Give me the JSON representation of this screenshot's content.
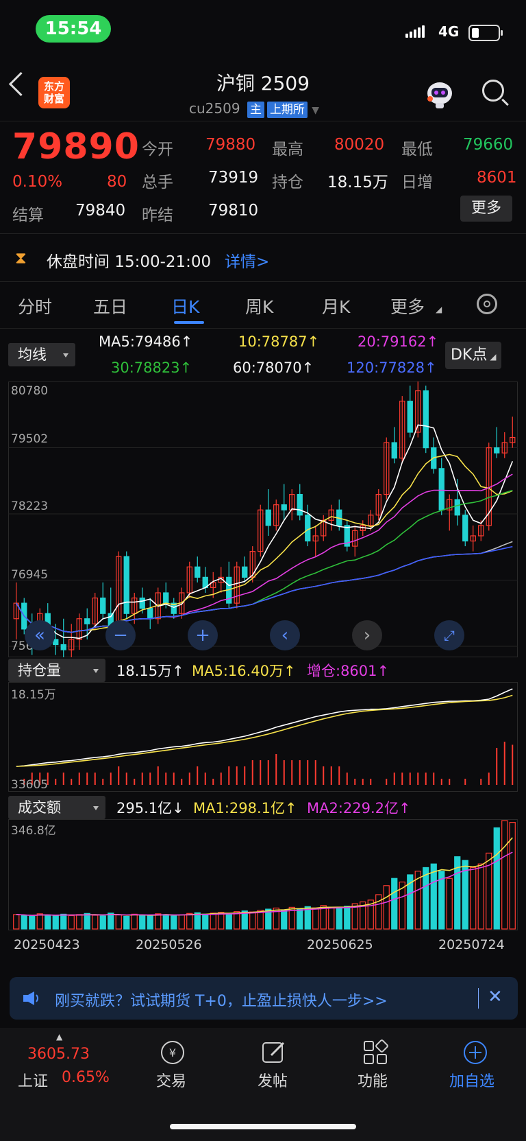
{
  "status_bar": {
    "time": "15:54",
    "network": "4G"
  },
  "header": {
    "logo_line1": "东方",
    "logo_line2": "财富",
    "title": "沪铜 2509",
    "code": "cu2509",
    "tag_main": "主",
    "tag_exchange": "上期所"
  },
  "quote": {
    "price": "79890",
    "change_pct": "0.10%",
    "change": "80",
    "open_label": "今开",
    "open": "79880",
    "high_label": "最高",
    "high": "80020",
    "low_label": "最低",
    "low": "79660",
    "volume_label": "总手",
    "volume": "73919",
    "position_label": "持仓",
    "position": "18.15万",
    "daily_inc_label": "日增",
    "daily_inc": "8601",
    "settle_label": "结算",
    "settle": "79840",
    "prev_settle_label": "昨结",
    "prev_settle": "79810",
    "more": "更多"
  },
  "notice": {
    "text": "休盘时间 15:00-21:00",
    "link": "详情>"
  },
  "tabs": [
    "分时",
    "五日",
    "日K",
    "周K",
    "月K",
    "更多"
  ],
  "ma_bar": {
    "selector": "均线",
    "ma5": "MA5:79486↑",
    "ma10": "10:78787↑",
    "ma20": "20:79162↑",
    "ma30": "30:78823↑",
    "ma60": "60:78070↑",
    "ma120": "120:77828↑",
    "dk": "DK点"
  },
  "kline_axis": [
    "80780",
    "79502",
    "78223",
    "76945",
    "75667"
  ],
  "position_bar": {
    "selector": "持仓量",
    "value": "18.15万↑",
    "ma5": "MA5:16.40万↑",
    "inc": "增仓:8601↑"
  },
  "position_axis": [
    "18.15万",
    "33605"
  ],
  "amount_bar": {
    "selector": "成交额",
    "value": "295.1亿↓",
    "ma1": "MA1:298.1亿↑",
    "ma2": "MA2:229.2亿↑"
  },
  "amount_axis": [
    "346.8亿"
  ],
  "dates": [
    "20250423",
    "20250526",
    "20250625",
    "20250724"
  ],
  "banner": {
    "text": "刚买就跌？试试期货 T+0，止盈止损快人一步>>"
  },
  "bottom_nav": {
    "index_value": "3605.73",
    "index_name": "上证",
    "index_change": "0.65%",
    "items": [
      "交易",
      "发帖",
      "功能",
      "加自选"
    ]
  },
  "colors": {
    "up": "#ff3b30",
    "down": "#22d3d3",
    "accent": "#3d86ff",
    "background": "#0b0b0d"
  },
  "chart_data": {
    "type": "candlestick",
    "title": "沪铜 2509 日K",
    "ylim": [
      75667,
      80780
    ],
    "y_ticks": [
      80780,
      79502,
      78223,
      76945,
      75667
    ],
    "x_ticks": [
      "20250423",
      "20250526",
      "20250625",
      "20250724"
    ],
    "candles": [
      [
        76200,
        76900,
        75800,
        76500
      ],
      [
        76500,
        76600,
        75900,
        76000
      ],
      [
        76000,
        76300,
        75500,
        75800
      ],
      [
        75800,
        76400,
        75700,
        76300
      ],
      [
        76300,
        76500,
        75700,
        75800
      ],
      [
        75800,
        76100,
        75500,
        75700
      ],
      [
        75700,
        76200,
        75400,
        75600
      ],
      [
        75600,
        76100,
        75300,
        75800
      ],
      [
        75800,
        76300,
        75600,
        76200
      ],
      [
        76200,
        76400,
        75800,
        76100
      ],
      [
        76100,
        76700,
        76000,
        76600
      ],
      [
        76600,
        76900,
        76200,
        76300
      ],
      [
        76300,
        76800,
        75900,
        76000
      ],
      [
        76000,
        77500,
        75900,
        77400
      ],
      [
        77400,
        77500,
        76200,
        76300
      ],
      [
        76300,
        76700,
        76100,
        76600
      ],
      [
        76600,
        76800,
        76300,
        76400
      ],
      [
        76400,
        76600,
        76000,
        76200
      ],
      [
        76200,
        76800,
        76100,
        76700
      ],
      [
        76700,
        76900,
        76400,
        76500
      ],
      [
        76500,
        76600,
        76200,
        76300
      ],
      [
        76300,
        76800,
        76200,
        76700
      ],
      [
        76700,
        77300,
        76600,
        77200
      ],
      [
        77200,
        77400,
        76900,
        77000
      ],
      [
        77000,
        77200,
        76700,
        76800
      ],
      [
        76800,
        77100,
        76600,
        76900
      ],
      [
        76900,
        77200,
        76700,
        77000
      ],
      [
        77000,
        77300,
        76400,
        76500
      ],
      [
        76500,
        77300,
        76400,
        77200
      ],
      [
        77200,
        77400,
        76900,
        77000
      ],
      [
        77000,
        77600,
        76900,
        77500
      ],
      [
        77500,
        78400,
        77400,
        78300
      ],
      [
        78300,
        78700,
        77800,
        78000
      ],
      [
        78000,
        78500,
        77900,
        78400
      ],
      [
        78400,
        78800,
        78100,
        78300
      ],
      [
        78300,
        78700,
        78100,
        78600
      ],
      [
        78600,
        78800,
        78100,
        78200
      ],
      [
        78200,
        78400,
        77600,
        77700
      ],
      [
        77700,
        78000,
        77400,
        77800
      ],
      [
        77800,
        78200,
        77700,
        78100
      ],
      [
        78100,
        78400,
        77900,
        78300
      ],
      [
        78300,
        78500,
        77900,
        78000
      ],
      [
        78000,
        78100,
        77500,
        77600
      ],
      [
        77600,
        78000,
        77400,
        77900
      ],
      [
        77900,
        78100,
        77800,
        78000
      ],
      [
        78000,
        78300,
        77900,
        78200
      ],
      [
        78200,
        78700,
        78100,
        78600
      ],
      [
        78600,
        79700,
        78500,
        79600
      ],
      [
        79600,
        79900,
        79200,
        79300
      ],
      [
        79300,
        80500,
        79200,
        80400
      ],
      [
        80400,
        80700,
        79700,
        79800
      ],
      [
        79800,
        80800,
        79700,
        80600
      ],
      [
        80600,
        80700,
        79400,
        79500
      ],
      [
        79500,
        79700,
        79000,
        79100
      ],
      [
        79100,
        79300,
        78200,
        78300
      ],
      [
        78300,
        78600,
        77900,
        78500
      ],
      [
        78500,
        78900,
        78000,
        78200
      ],
      [
        78200,
        78300,
        77600,
        77700
      ],
      [
        77700,
        78000,
        77500,
        77800
      ],
      [
        77800,
        78100,
        77700,
        78000
      ],
      [
        78000,
        79600,
        77900,
        79500
      ],
      [
        79500,
        79900,
        79300,
        79400
      ],
      [
        79400,
        79800,
        79300,
        79600
      ],
      [
        79600,
        80100,
        79500,
        79700
      ]
    ],
    "position_bars": [
      3.5,
      3.6,
      3.8,
      4.0,
      4.2,
      4.3,
      4.5,
      4.6,
      4.8,
      5.0,
      5.2,
      5.3,
      5.5,
      5.8,
      6.0,
      6.1,
      6.3,
      6.5,
      6.8,
      7.0,
      7.2,
      7.3,
      7.5,
      7.8,
      8.0,
      8.1,
      8.3,
      8.6,
      8.9,
      9.2,
      9.6,
      10.0,
      10.4,
      10.9,
      11.3,
      11.7,
      12.1,
      12.5,
      12.9,
      13.2,
      13.5,
      13.8,
      14.0,
      14.1,
      14.2,
      14.3,
      14.3,
      14.4,
      14.6,
      14.8,
      15.0,
      15.2,
      15.4,
      15.6,
      15.7,
      15.8,
      15.8,
      15.9,
      15.9,
      16.0,
      16.2,
      16.8,
      17.5,
      18.15
    ],
    "amount_bars": [
      40,
      38,
      35,
      42,
      39,
      36,
      41,
      37,
      40,
      43,
      38,
      36,
      44,
      39,
      35,
      41,
      37,
      38,
      42,
      40,
      36,
      39,
      43,
      45,
      41,
      44,
      46,
      42,
      48,
      50,
      47,
      52,
      55,
      58,
      53,
      60,
      56,
      62,
      58,
      65,
      60,
      57,
      63,
      70,
      75,
      80,
      95,
      120,
      140,
      130,
      150,
      160,
      170,
      180,
      160,
      140,
      200,
      190,
      170,
      180,
      210,
      280,
      300,
      295
    ]
  }
}
